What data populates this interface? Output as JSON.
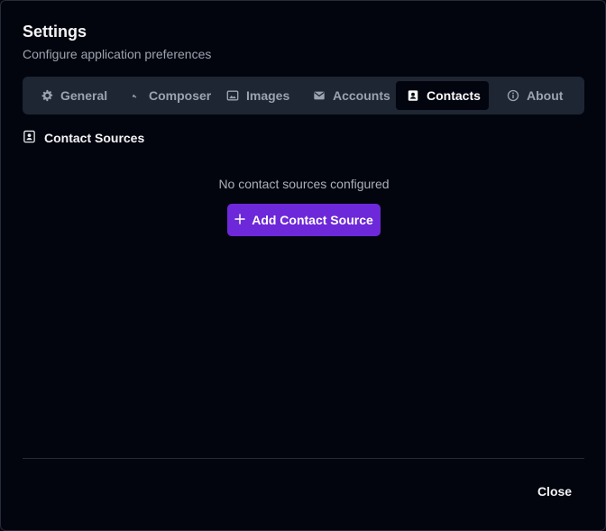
{
  "dialog": {
    "title": "Settings",
    "subtitle": "Configure application preferences"
  },
  "tabs": [
    {
      "label": "General",
      "icon": "gear-icon",
      "active": false
    },
    {
      "label": "Composer",
      "icon": "pen-icon",
      "active": false
    },
    {
      "label": "Images",
      "icon": "image-icon",
      "active": false
    },
    {
      "label": "Accounts",
      "icon": "envelope-icon",
      "active": false
    },
    {
      "label": "Contacts",
      "icon": "contact-card-icon",
      "active": true
    },
    {
      "label": "About",
      "icon": "info-icon",
      "active": false
    }
  ],
  "section": {
    "heading": "Contact Sources",
    "icon": "contact-card-icon"
  },
  "empty_state": {
    "message": "No contact sources configured",
    "add_button_label": "Add Contact Source",
    "add_icon": "plus-icon"
  },
  "footer": {
    "close_label": "Close"
  },
  "colors": {
    "background": "#03050e",
    "tabbar": "#1e2533",
    "accent": "#6d28d9"
  }
}
